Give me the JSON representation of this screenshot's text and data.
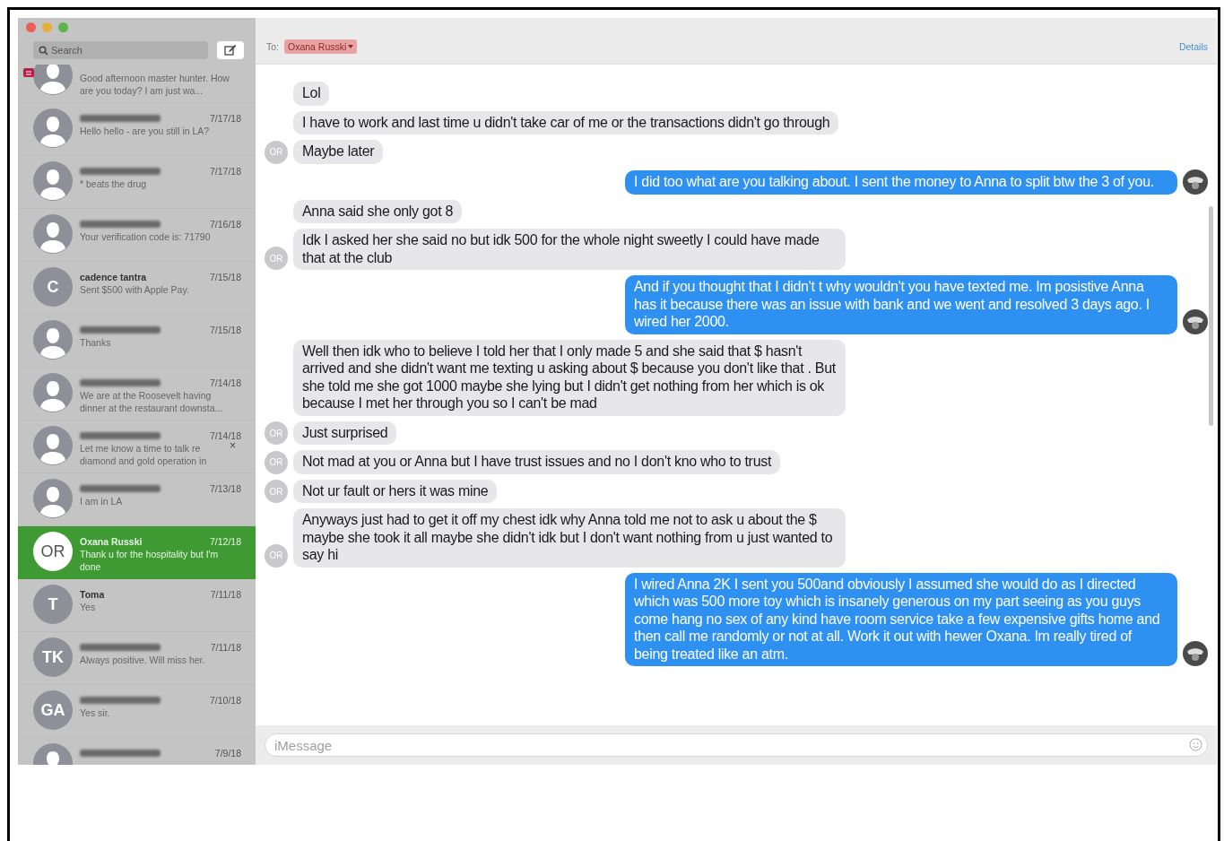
{
  "sidebar": {
    "search": {
      "placeholder": "Search"
    },
    "conversations": [
      {
        "name_redacted": false,
        "preview": "Good afternoon master hunter. How are you today?  I am just wa...",
        "flagged": true,
        "selected": false
      },
      {
        "name_redacted": true,
        "date": "7/17/18",
        "preview": "Hello hello - are you still in LA?",
        "flagged": false,
        "selected": false
      },
      {
        "name_redacted": true,
        "date": "7/17/18",
        "preview": "* beats the drug",
        "flagged": false,
        "selected": false
      },
      {
        "name_redacted": true,
        "date": "7/16/18",
        "preview": "Your verification code is: 71790",
        "flagged": false,
        "selected": false
      },
      {
        "name_redacted": false,
        "name": "cadence tantra",
        "initials": "C",
        "date": "7/15/18",
        "preview": "Sent $500 with Apple Pay.",
        "flagged": false,
        "selected": false
      },
      {
        "name_redacted": true,
        "date": "7/15/18",
        "preview": "Thanks",
        "flagged": false,
        "selected": false
      },
      {
        "name_redacted": true,
        "date": "7/14/18",
        "preview": "We are at the Roosevelt having dinner at the restaurant downsta...",
        "flagged": false,
        "selected": false
      },
      {
        "name_redacted": true,
        "date": "7/14/18",
        "preview": "Let me know a time to talk re diamond and gold operation in",
        "flagged": false,
        "dismiss_icon": "×",
        "selected": false
      },
      {
        "name_redacted": true,
        "date": "7/13/18",
        "preview": "I am in LA",
        "flagged": false,
        "selected": false
      },
      {
        "name_redacted": false,
        "name": "Oxana Russki",
        "initials": "OR",
        "date": "7/12/18",
        "preview": "Thank u for the hospitality but I'm done",
        "flagged": false,
        "selected": true
      },
      {
        "name_redacted": false,
        "name": "Toma",
        "initials": "T",
        "date": "7/11/18",
        "preview": "Yes",
        "flagged": false,
        "selected": false
      },
      {
        "name_redacted": true,
        "initials": "TK",
        "date": "7/11/18",
        "preview": "Always positive. Will miss her.",
        "flagged": false,
        "selected": false
      },
      {
        "name_redacted": true,
        "initials": "GA",
        "date": "7/10/18",
        "preview": "Yes sir.",
        "flagged": false,
        "selected": false
      },
      {
        "name_redacted": true,
        "date": "7/9/18",
        "flagged": false,
        "selected": false
      }
    ]
  },
  "chat": {
    "to_label": "To:",
    "recipient": "Oxana Russki",
    "details": "Details",
    "messages": [
      {
        "kind": "incoming",
        "text": "Lol"
      },
      {
        "kind": "incoming",
        "text": "I have to work and last time u didn't take car of me or the transactions didn't go through"
      },
      {
        "kind": "incoming",
        "text": "Maybe later",
        "avatar": "OR"
      },
      {
        "kind": "outgoing",
        "text": "I did too what are you talking about.  I sent the money to Anna to split btw the 3 of you."
      },
      {
        "kind": "incoming",
        "text": "Anna said she only got 8"
      },
      {
        "kind": "incoming",
        "text": "Idk I asked her she said no but idk 500 for the whole night sweetly I could have made that at the club",
        "avatar": "OR"
      },
      {
        "kind": "outgoing",
        "text": "And if you thought that I didn't t why wouldn't you have texted me.  Im posistive Anna has it because there was an issue with bank and we went and resolved 3 days ago. I wired her 2000."
      },
      {
        "kind": "incoming",
        "text": "Well then idk who to believe I told her that I only made 5 and she said that $ hasn't arrived and she didn't want me texting u asking about $ because you don't like that . But she told me she got 1000 maybe she lying but I didn't get nothing from her which is ok because I met her through you so I can't be mad"
      },
      {
        "kind": "incoming",
        "text": "Just surprised",
        "avatar": "OR"
      },
      {
        "kind": "incoming",
        "text": "Not mad at you or Anna  but I have trust issues and no I don't kno who to trust",
        "avatar": "OR"
      },
      {
        "kind": "incoming",
        "text": "Not ur fault or hers it was mine",
        "avatar": "OR"
      },
      {
        "kind": "incoming",
        "text": "Anyways just had to get it off my chest idk why Anna told me not to ask u about the $ maybe she took it all maybe she didn't idk but I don't want nothing from u just wanted to say hi",
        "avatar": "OR"
      },
      {
        "kind": "outgoing",
        "text": "I wired Anna 2K I sent you 500and obviously I assumed she would do as I directed which was 500 more toy which is insanely generous on my part seeing as you guys come hang no sex of any kind have room service take a few expensive gifts home and then call me randomly or not at all. Work it out with hewer Oxana. Im really tired of being treated like an atm."
      }
    ],
    "compose": {
      "placeholder": "iMessage"
    }
  }
}
